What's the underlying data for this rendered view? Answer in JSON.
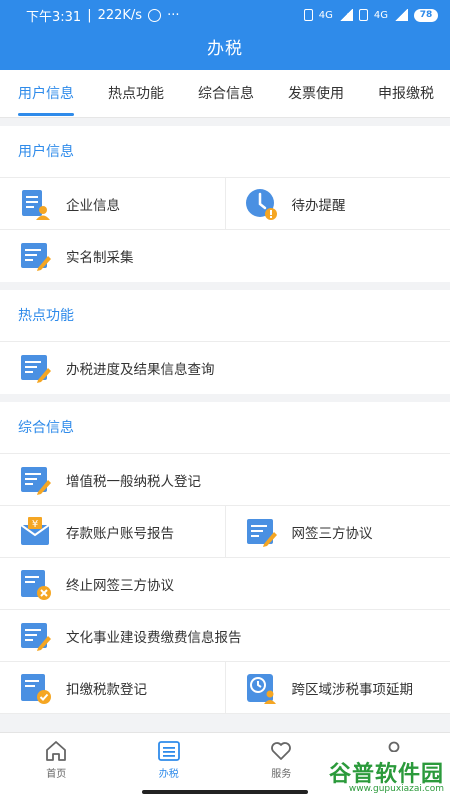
{
  "status_bar": {
    "time": "下午3:31",
    "speed": "222K/s",
    "dots": "···",
    "net1": "4G",
    "net2": "4G",
    "battery": "78"
  },
  "header": {
    "title": "办税"
  },
  "tabs": [
    {
      "label": "用户信息",
      "active": true
    },
    {
      "label": "热点功能",
      "active": false
    },
    {
      "label": "综合信息",
      "active": false
    },
    {
      "label": "发票使用",
      "active": false
    },
    {
      "label": "申报缴税",
      "active": false
    }
  ],
  "sections": {
    "user_info": {
      "title": "用户信息",
      "items": [
        {
          "label": "企业信息",
          "icon": "company-doc-icon"
        },
        {
          "label": "待办提醒",
          "icon": "clock-alert-icon"
        },
        {
          "label": "实名制采集",
          "icon": "form-edit-icon"
        }
      ]
    },
    "hot": {
      "title": "热点功能",
      "items": [
        {
          "label": "办税进度及结果信息查询",
          "icon": "form-edit-icon"
        }
      ]
    },
    "general": {
      "title": "综合信息",
      "items": [
        {
          "label": "增值税一般纳税人登记",
          "icon": "form-edit-icon"
        },
        {
          "label": "存款账户账号报告",
          "icon": "bank-yuan-icon"
        },
        {
          "label": "网签三方协议",
          "icon": "form-edit-icon"
        },
        {
          "label": "终止网签三方协议",
          "icon": "doc-cancel-icon"
        },
        {
          "label": "文化事业建设费缴费信息报告",
          "icon": "form-edit-icon"
        },
        {
          "label": "扣缴税款登记",
          "icon": "doc-check-icon"
        },
        {
          "label": "跨区域涉税事项延期",
          "icon": "clock-user-icon"
        }
      ]
    }
  },
  "navbar": [
    {
      "label": "首页",
      "icon": "home-icon",
      "active": false
    },
    {
      "label": "办税",
      "icon": "list-icon",
      "active": true
    },
    {
      "label": "服务",
      "icon": "heart-icon",
      "active": false
    },
    {
      "label": "",
      "icon": "user-icon",
      "active": false
    }
  ],
  "watermark": {
    "logo": "谷普软件园",
    "url": "www.gupuxiazai.com"
  },
  "colors": {
    "primary": "#2f8bea",
    "icon_blue": "#4a90e2",
    "icon_orange": "#f5a623"
  }
}
